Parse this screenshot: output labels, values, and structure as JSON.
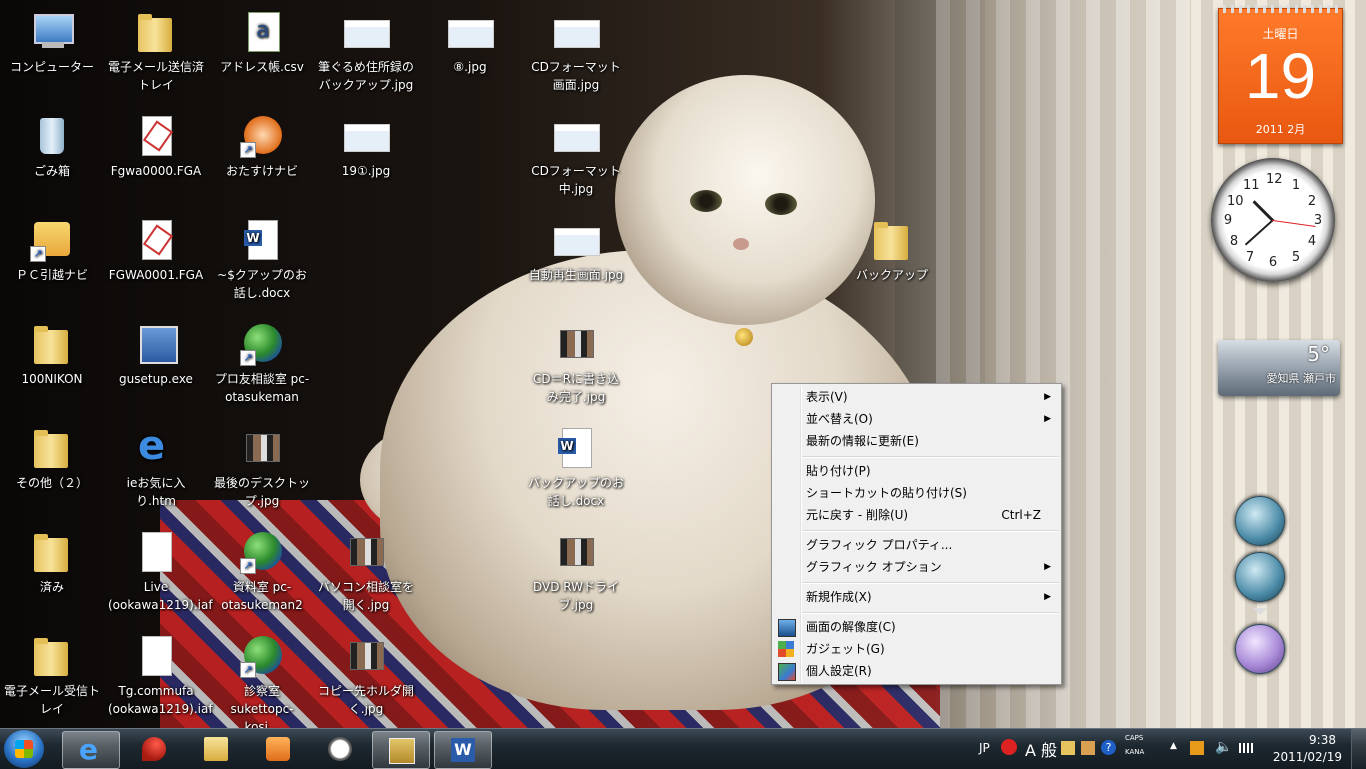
{
  "desktop": {
    "icons": [
      {
        "label": "コンピューター"
      },
      {
        "label": "ごみ箱"
      },
      {
        "label": "ＰＣ引越ナビ"
      },
      {
        "label": "100NIKON"
      },
      {
        "label": "その他（２）"
      },
      {
        "label": "済み"
      },
      {
        "label": "電子メール受信トレイ"
      },
      {
        "label": "電子メール送信済トレイ"
      },
      {
        "label": "Fgwa0000.FGA"
      },
      {
        "label": "FGWA0001.FGA"
      },
      {
        "label": "gusetup.exe"
      },
      {
        "label": "ieお気に入り.htm"
      },
      {
        "label": "Live (ookawa1219).iaf"
      },
      {
        "label": "Tg.commufa (ookawa1219).iaf"
      },
      {
        "label": "アドレス帳.csv"
      },
      {
        "label": "おたすけナビ"
      },
      {
        "label": "~$クアップのお話し.docx"
      },
      {
        "label": "プロ友相談室 pc-otasukeman"
      },
      {
        "label": "最後のデスクトップ.jpg"
      },
      {
        "label": "資料室 pc-otasukeman2"
      },
      {
        "label": "診察室 sukettopc-kosi..."
      },
      {
        "label": "筆ぐるめ住所録のバックアップ.jpg"
      },
      {
        "label": "19①.jpg"
      },
      {
        "label": "パソコン相談室を開く.jpg"
      },
      {
        "label": "コピー先ホルダ開く.jpg"
      },
      {
        "label": "⑧.jpg"
      },
      {
        "label": "CDフォーマット画面.jpg"
      },
      {
        "label": "CDフォーマット中.jpg"
      },
      {
        "label": "自動再生画面.jpg"
      },
      {
        "label": "CD＝Rに書き込み完了.jpg"
      },
      {
        "label": "バックアップのお話し.docx"
      },
      {
        "label": "DVD RWドライブ.jpg"
      },
      {
        "label": "バックアップ"
      }
    ]
  },
  "context_menu": {
    "view": {
      "label": "表示(V)"
    },
    "sort": {
      "label": "並べ替え(O)"
    },
    "refresh": {
      "label": "最新の情報に更新(E)"
    },
    "paste": {
      "label": "貼り付け(P)"
    },
    "paste_shortcut": {
      "label": "ショートカットの貼り付け(S)"
    },
    "undo": {
      "label": "元に戻す - 削除(U)",
      "shortcut": "Ctrl+Z"
    },
    "graphics_props": {
      "label": "グラフィック プロパティ..."
    },
    "graphics_options": {
      "label": "グラフィック オプション"
    },
    "new": {
      "label": "新規作成(X)"
    },
    "resolution": {
      "label": "画面の解像度(C)"
    },
    "gadgets": {
      "label": "ガジェット(G)"
    },
    "personalize": {
      "label": "個人設定(R)"
    }
  },
  "gadgets": {
    "calendar": {
      "weekday": "土曜日",
      "day": "19",
      "year_month": "2011 2月"
    },
    "clock": {
      "numbers": [
        "12",
        "1",
        "2",
        "3",
        "4",
        "5",
        "6",
        "7",
        "8",
        "9",
        "10",
        "11"
      ]
    },
    "weather": {
      "temp": "5°",
      "city": "愛知県 瀬戸市"
    }
  },
  "taskbar": {
    "tray": {
      "lang": "JP",
      "ime_mode": "A 般",
      "caps": "CAPS",
      "kana": "KANA",
      "time": "9:38",
      "date": "2011/02/19"
    }
  },
  "colors": {
    "calendar_orange": "#e85810",
    "menu_bg": "#f0f0f0",
    "taskbar": "#1e2830"
  }
}
